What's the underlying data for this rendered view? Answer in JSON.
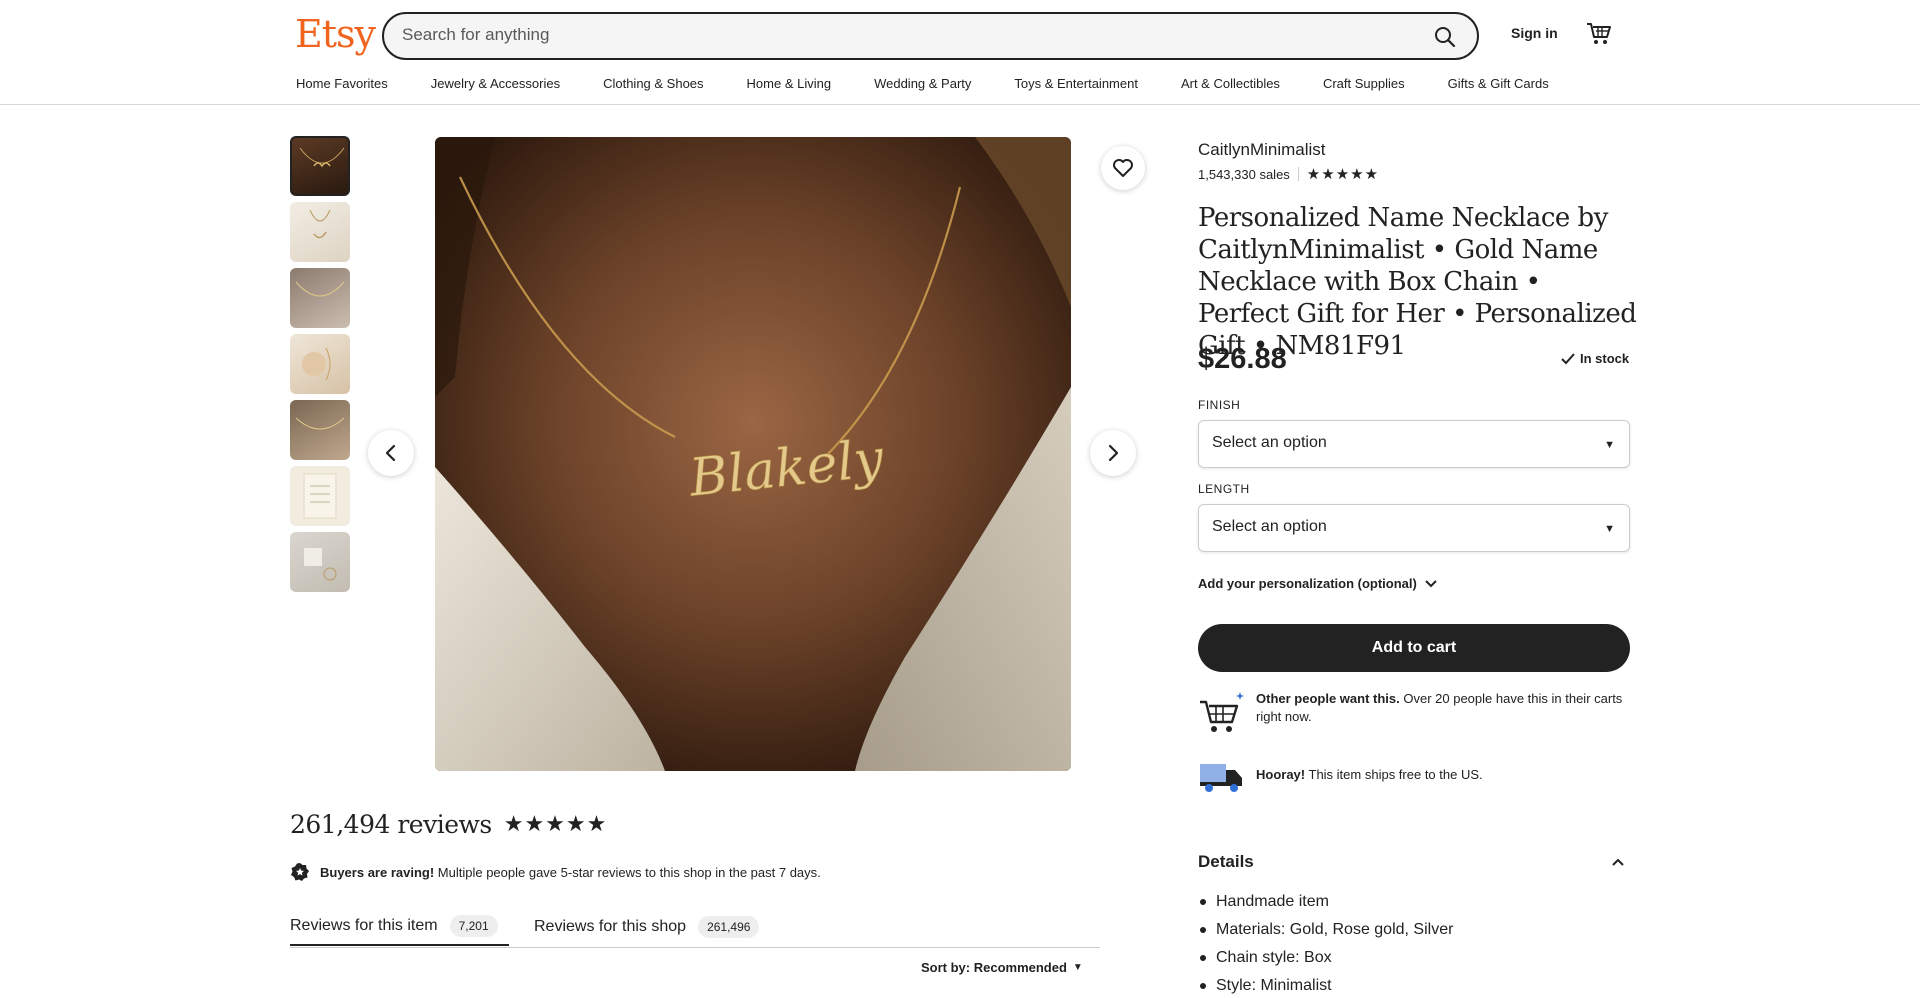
{
  "header": {
    "logo": "Etsy",
    "search_placeholder": "Search for anything",
    "sign_in": "Sign in",
    "nav": [
      "Home Favorites",
      "Jewelry & Accessories",
      "Clothing & Shoes",
      "Home & Living",
      "Wedding & Party",
      "Toys & Entertainment",
      "Art & Collectibles",
      "Craft Supplies",
      "Gifts & Gift Cards"
    ]
  },
  "gallery": {
    "thumbnail_count": 7,
    "image_text": "Blakely"
  },
  "listing": {
    "shop_name": "CaitlynMinimalist",
    "sales": "1,543,330 sales",
    "rating_stars": "★★★★★",
    "title": "Personalized Name Necklace by CaitlynMinimalist • Gold Name Necklace with Box Chain • Perfect Gift for Her • Personalized Gift • NM81F91",
    "price": "$26.88",
    "stock": "In stock",
    "options": [
      {
        "label": "FINISH",
        "value": "Select an option"
      },
      {
        "label": "LENGTH",
        "value": "Select an option"
      }
    ],
    "personalization": "Add your personalization (optional)",
    "add_to_cart": "Add to cart",
    "promo_cart_bold": "Other people want this.",
    "promo_cart_text": " Over 20 people have this in their carts right now.",
    "promo_ship_bold": "Hooray!",
    "promo_ship_text": " This item ships free to the US."
  },
  "details": {
    "heading": "Details",
    "items": [
      "Handmade item",
      "Materials: Gold, Rose gold, Silver",
      "Chain style: Box",
      "Style: Minimalist"
    ]
  },
  "reviews": {
    "count": "261,494 reviews",
    "stars": "★★★★★",
    "raving_bold": "Buyers are raving!",
    "raving_text": " Multiple people gave 5-star reviews to this shop in the past 7 days.",
    "tabs": [
      {
        "label": "Reviews for this item",
        "count": "7,201"
      },
      {
        "label": "Reviews for this shop",
        "count": "261,496"
      }
    ],
    "sort": "Sort by: Recommended"
  },
  "colors": {
    "brand": "#f1641e",
    "primary_button": "#222222"
  }
}
